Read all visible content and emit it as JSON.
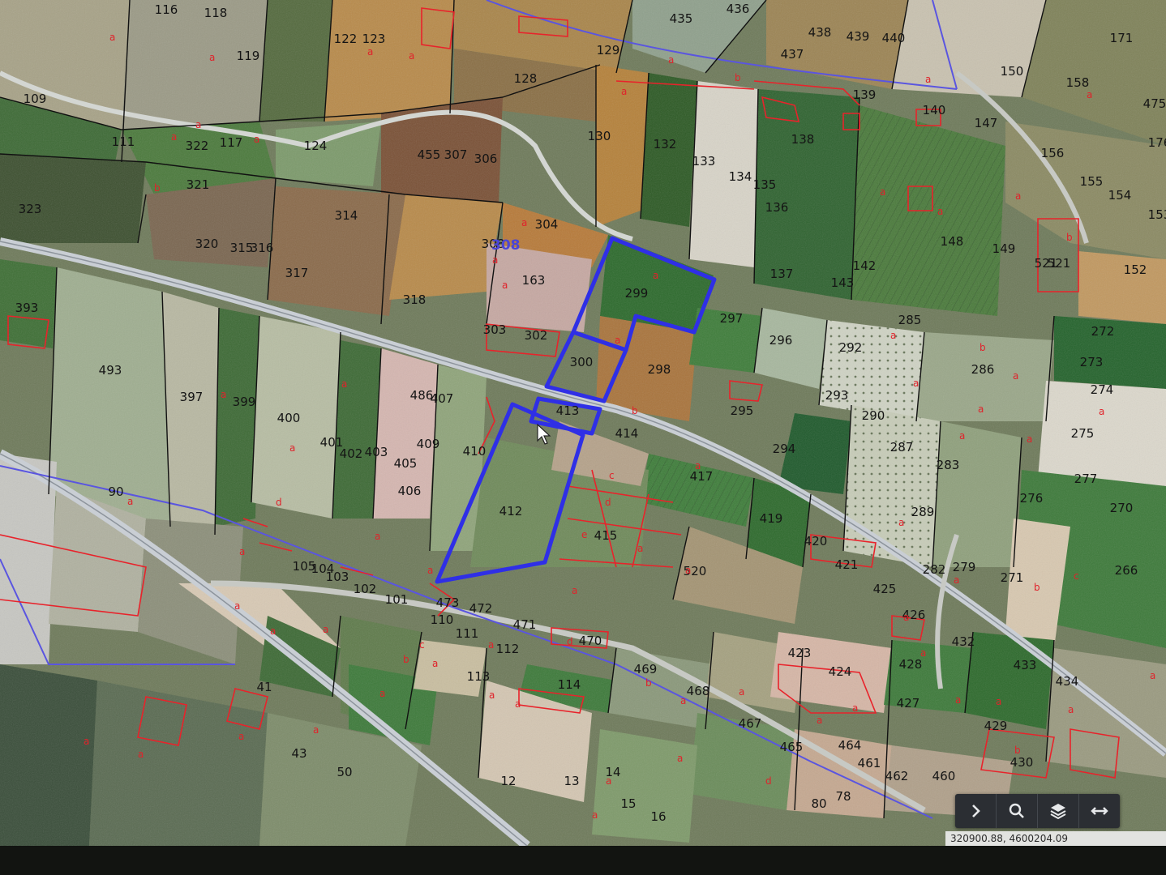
{
  "map": {
    "parcels": [
      {
        "n": "116"
      },
      {
        "n": "118"
      },
      {
        "n": "119"
      },
      {
        "n": "122"
      },
      {
        "n": "123"
      },
      {
        "n": "109"
      },
      {
        "n": "111"
      },
      {
        "n": "117"
      },
      {
        "n": "124"
      },
      {
        "n": "128"
      },
      {
        "n": "129"
      },
      {
        "n": "435"
      },
      {
        "n": "436"
      },
      {
        "n": "437"
      },
      {
        "n": "438"
      },
      {
        "n": "439"
      },
      {
        "n": "440"
      },
      {
        "n": "150"
      },
      {
        "n": "158"
      },
      {
        "n": "171"
      },
      {
        "n": "475"
      },
      {
        "n": "176"
      },
      {
        "n": "130"
      },
      {
        "n": "132"
      },
      {
        "n": "133"
      },
      {
        "n": "134"
      },
      {
        "n": "135"
      },
      {
        "n": "136"
      },
      {
        "n": "138"
      },
      {
        "n": "139"
      },
      {
        "n": "140"
      },
      {
        "n": "147"
      },
      {
        "n": "156"
      },
      {
        "n": "155"
      },
      {
        "n": "154"
      },
      {
        "n": "153"
      },
      {
        "n": "455"
      },
      {
        "n": "307"
      },
      {
        "n": "306"
      },
      {
        "n": "322"
      },
      {
        "n": "321"
      },
      {
        "n": "323"
      },
      {
        "n": "314"
      },
      {
        "n": "304"
      },
      {
        "n": "308"
      },
      {
        "n": "163"
      },
      {
        "n": "318"
      },
      {
        "n": "317"
      },
      {
        "n": "320"
      },
      {
        "n": "315"
      },
      {
        "n": "316"
      },
      {
        "n": "299"
      },
      {
        "n": "297"
      },
      {
        "n": "137"
      },
      {
        "n": "143"
      },
      {
        "n": "142"
      },
      {
        "n": "148"
      },
      {
        "n": "149"
      },
      {
        "n": "521"
      },
      {
        "n": "152"
      },
      {
        "n": "393"
      },
      {
        "n": "493"
      },
      {
        "n": "397"
      },
      {
        "n": "399"
      },
      {
        "n": "400"
      },
      {
        "n": "303"
      },
      {
        "n": "302"
      },
      {
        "n": "300"
      },
      {
        "n": "298"
      },
      {
        "n": "296"
      },
      {
        "n": "292"
      },
      {
        "n": "285"
      },
      {
        "n": "286"
      },
      {
        "n": "272"
      },
      {
        "n": "273"
      },
      {
        "n": "274"
      },
      {
        "n": "275"
      },
      {
        "n": "293"
      },
      {
        "n": "295"
      },
      {
        "n": "486"
      },
      {
        "n": "407"
      },
      {
        "n": "413"
      },
      {
        "n": "414"
      },
      {
        "n": "401"
      },
      {
        "n": "402"
      },
      {
        "n": "403"
      },
      {
        "n": "405"
      },
      {
        "n": "406"
      },
      {
        "n": "409"
      },
      {
        "n": "410"
      },
      {
        "n": "412"
      },
      {
        "n": "415"
      },
      {
        "n": "417"
      },
      {
        "n": "294"
      },
      {
        "n": "290"
      },
      {
        "n": "287"
      },
      {
        "n": "283"
      },
      {
        "n": "289"
      },
      {
        "n": "276"
      },
      {
        "n": "277"
      },
      {
        "n": "270"
      },
      {
        "n": "266"
      },
      {
        "n": "419"
      },
      {
        "n": "420"
      },
      {
        "n": "421"
      },
      {
        "n": "520"
      },
      {
        "n": "425"
      },
      {
        "n": "426"
      },
      {
        "n": "282"
      },
      {
        "n": "279"
      },
      {
        "n": "271"
      },
      {
        "n": "90"
      },
      {
        "n": "105"
      },
      {
        "n": "104"
      },
      {
        "n": "103"
      },
      {
        "n": "102"
      },
      {
        "n": "101"
      },
      {
        "n": "473"
      },
      {
        "n": "472"
      },
      {
        "n": "110"
      },
      {
        "n": "111"
      },
      {
        "n": "471"
      },
      {
        "n": "470"
      },
      {
        "n": "112"
      },
      {
        "n": "113"
      },
      {
        "n": "114"
      },
      {
        "n": "469"
      },
      {
        "n": "468"
      },
      {
        "n": "423"
      },
      {
        "n": "424"
      },
      {
        "n": "428"
      },
      {
        "n": "432"
      },
      {
        "n": "433"
      },
      {
        "n": "434"
      },
      {
        "n": "429"
      },
      {
        "n": "430"
      },
      {
        "n": "427"
      },
      {
        "n": "467"
      },
      {
        "n": "465"
      },
      {
        "n": "464"
      },
      {
        "n": "461"
      },
      {
        "n": "462"
      },
      {
        "n": "460"
      },
      {
        "n": "41"
      },
      {
        "n": "43"
      },
      {
        "n": "50"
      },
      {
        "n": "12"
      },
      {
        "n": "13"
      },
      {
        "n": "14"
      },
      {
        "n": "15"
      },
      {
        "n": "16"
      },
      {
        "n": "80"
      },
      {
        "n": "78"
      },
      {
        "n": "521"
      }
    ],
    "subparcels": [
      "a",
      "b",
      "c",
      "d",
      "e",
      "f"
    ],
    "highlight_label": "308",
    "colors": {
      "highlight_outline": "#2f2fe6",
      "subparcel_line": "#e8232b",
      "parcel_line": "#111111",
      "road": "#b9c0c8",
      "boundary": "#5a55e0"
    }
  },
  "toolbar": {
    "buttons": [
      {
        "icon": "chevron-right-icon"
      },
      {
        "icon": "search-icon"
      },
      {
        "icon": "layers-icon"
      },
      {
        "icon": "measure-icon"
      }
    ]
  },
  "coordinates": "320900.88, 4600204.09"
}
